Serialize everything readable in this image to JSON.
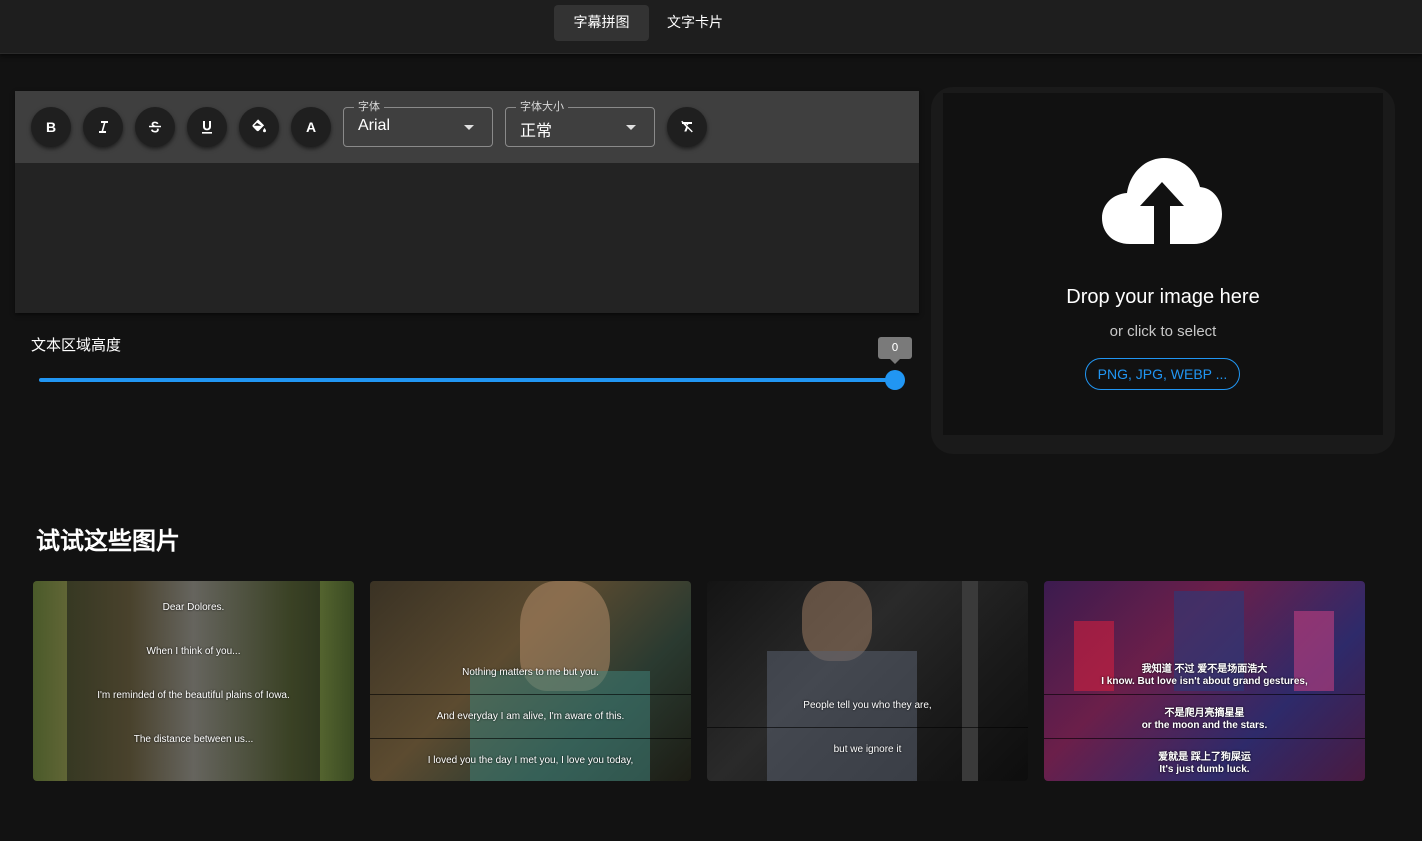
{
  "nav": {
    "tabs": [
      {
        "label": "字幕拼图",
        "active": true
      },
      {
        "label": "文字卡片",
        "active": false
      }
    ]
  },
  "toolbar": {
    "buttons": [
      {
        "label": "B",
        "icon": "bold-icon"
      },
      {
        "label": "I",
        "icon": "italic-icon"
      },
      {
        "label": "S",
        "icon": "strikethrough-icon"
      },
      {
        "label": "U",
        "icon": "underline-icon"
      },
      {
        "label": "",
        "icon": "fill-color-icon"
      },
      {
        "label": "A",
        "icon": "text-color-icon"
      }
    ],
    "font": {
      "label": "字体",
      "value": "Arial"
    },
    "font_size": {
      "label": "字体大小",
      "value": "正常"
    },
    "clear_format_icon": "clear-format-icon"
  },
  "slider": {
    "label": "文本区域高度",
    "value": "0",
    "accent": "#2196f3"
  },
  "dropzone": {
    "icon": "cloud-upload-icon",
    "title": "Drop your image here",
    "subtitle": "or click to select",
    "formats": "PNG, JPG, WEBP ..."
  },
  "gallery": {
    "title": "试试这些图片",
    "items": [
      {
        "captions": [
          "Dear Dolores.",
          "When I think of you...",
          "I'm reminded of the beautiful plains of Iowa.",
          "The distance between us..."
        ]
      },
      {
        "captions": [
          "Nothing matters to me but you.",
          "And everyday I am alive, I'm aware of this.",
          "I loved you the day I met you, I love you today,"
        ]
      },
      {
        "captions": [
          "People tell you who they are,",
          "but we ignore it"
        ]
      },
      {
        "captions": [
          "我知道 不过 爱不是场面浩大",
          "I know. But love isn't about grand gestures,",
          "不是爬月亮摘星星",
          "or the moon and the stars.",
          "爱就是 踩上了狗屎运",
          "It's just dumb luck."
        ]
      }
    ]
  }
}
